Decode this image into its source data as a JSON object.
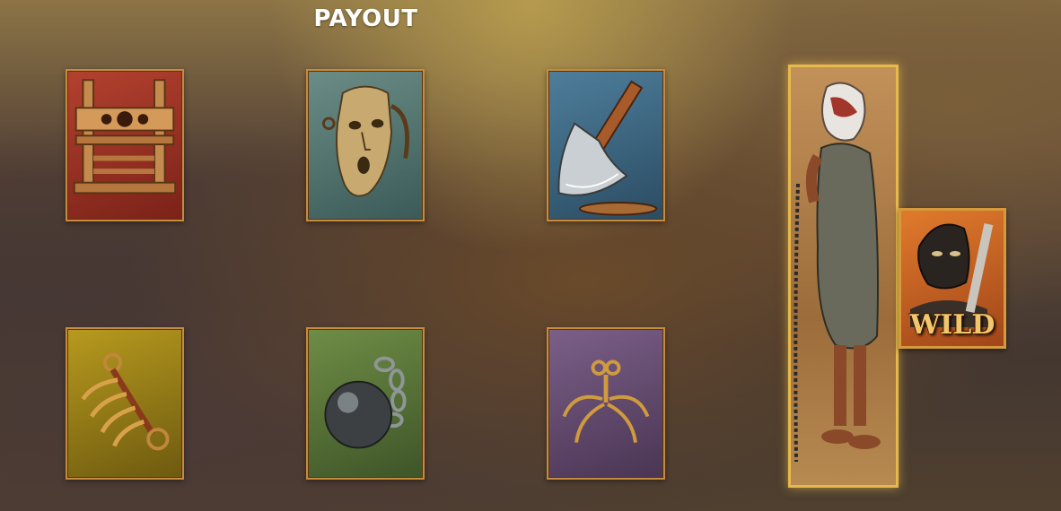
{
  "header": {
    "title": "PAYOUT"
  },
  "symbols": [
    {
      "name": "pillory",
      "icon": "pillory-icon",
      "tile_color": "#9a3122"
    },
    {
      "name": "mask",
      "icon": "mask-of-shame-icon",
      "tile_color": "#55756f"
    },
    {
      "name": "axe",
      "icon": "executioner-axe-icon",
      "tile_color": "#3e6580"
    },
    {
      "name": "claws",
      "icon": "iron-claw-icon",
      "tile_color": "#9a8119"
    },
    {
      "name": "ball-and-chain",
      "icon": "ball-and-chain-icon",
      "tile_color": "#567338"
    },
    {
      "name": "spider",
      "icon": "breast-ripper-icon",
      "tile_color": "#63496e"
    }
  ],
  "scatter": {
    "icon": "hooded-prisoner-icon"
  },
  "wild": {
    "label": "WILD",
    "icon": "executioner-icon"
  },
  "colors": {
    "frame": "#c68b3c",
    "scatter_glow": "#e6b94a",
    "title": "#ffffff"
  }
}
